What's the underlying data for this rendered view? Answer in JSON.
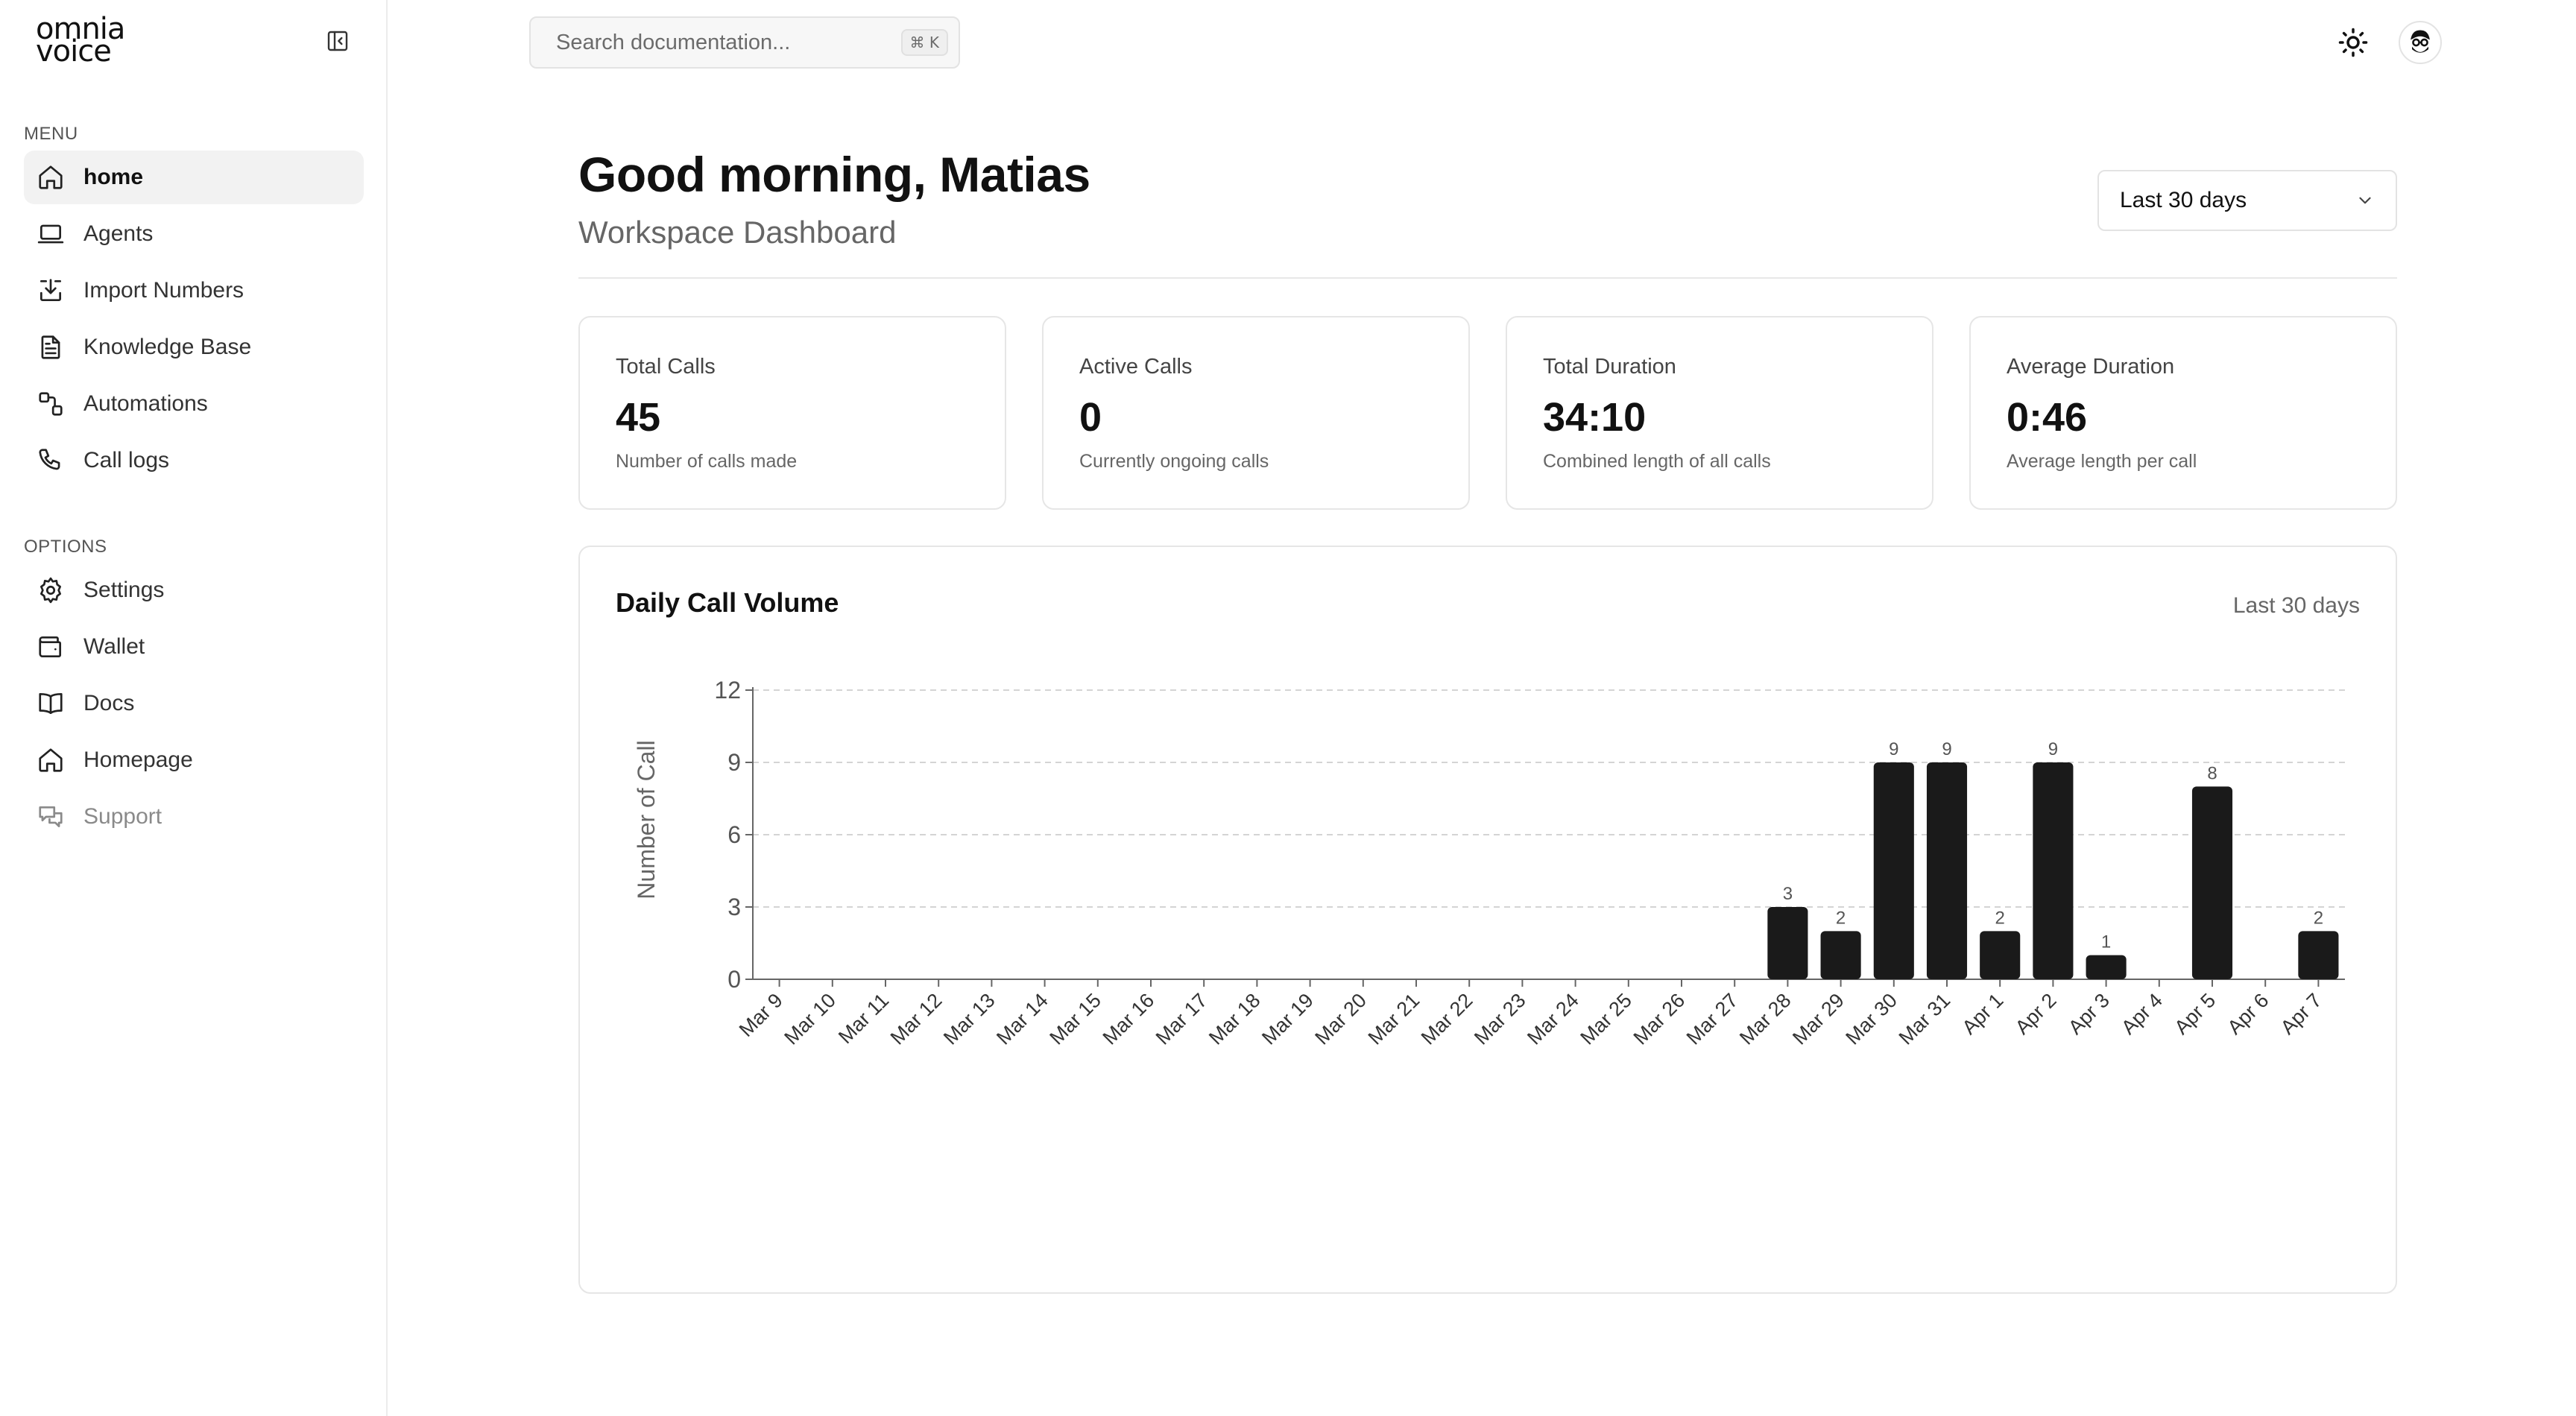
{
  "brand": {
    "line1": "omnia",
    "line2": "voice"
  },
  "sidebar": {
    "menu_label": "MENU",
    "options_label": "OPTIONS",
    "menu_items": [
      {
        "label": "home",
        "icon": "home-icon",
        "active": true
      },
      {
        "label": "Agents",
        "icon": "laptop-icon"
      },
      {
        "label": "Import Numbers",
        "icon": "import-icon"
      },
      {
        "label": "Knowledge Base",
        "icon": "document-icon"
      },
      {
        "label": "Automations",
        "icon": "workflow-icon"
      },
      {
        "label": "Call logs",
        "icon": "phone-icon"
      }
    ],
    "option_items": [
      {
        "label": "Settings",
        "icon": "gear-icon"
      },
      {
        "label": "Wallet",
        "icon": "wallet-icon"
      },
      {
        "label": "Docs",
        "icon": "book-icon"
      },
      {
        "label": "Homepage",
        "icon": "home-icon"
      },
      {
        "label": "Support",
        "icon": "chat-icon",
        "muted": true
      }
    ]
  },
  "topbar": {
    "search_placeholder": "Search documentation...",
    "search_shortcut": "⌘ K"
  },
  "header": {
    "greeting": "Good morning, Matias",
    "subtitle": "Workspace Dashboard",
    "range_label": "Last 30 days"
  },
  "stats": [
    {
      "label": "Total Calls",
      "value": "45",
      "desc": "Number of calls made"
    },
    {
      "label": "Active Calls",
      "value": "0",
      "desc": "Currently ongoing calls"
    },
    {
      "label": "Total Duration",
      "value": "34:10",
      "desc": "Combined length of all calls"
    },
    {
      "label": "Average Duration",
      "value": "0:46",
      "desc": "Average length per call"
    }
  ],
  "chart_card": {
    "title": "Daily Call Volume",
    "range": "Last 30 days"
  },
  "chart_data": {
    "type": "bar",
    "title": "Daily Call Volume",
    "xlabel": "",
    "ylabel": "Number of Call",
    "ylim": [
      0,
      12
    ],
    "yticks": [
      0,
      3,
      6,
      9,
      12
    ],
    "grid": true,
    "bar_color": "#1a1a1a",
    "categories": [
      "Mar 9",
      "Mar 10",
      "Mar 11",
      "Mar 12",
      "Mar 13",
      "Mar 14",
      "Mar 15",
      "Mar 16",
      "Mar 17",
      "Mar 18",
      "Mar 19",
      "Mar 20",
      "Mar 21",
      "Mar 22",
      "Mar 23",
      "Mar 24",
      "Mar 25",
      "Mar 26",
      "Mar 27",
      "Mar 28",
      "Mar 29",
      "Mar 30",
      "Mar 31",
      "Apr 1",
      "Apr 2",
      "Apr 3",
      "Apr 4",
      "Apr 5",
      "Apr 6",
      "Apr 7"
    ],
    "values": [
      0,
      0,
      0,
      0,
      0,
      0,
      0,
      0,
      0,
      0,
      0,
      0,
      0,
      0,
      0,
      0,
      0,
      0,
      0,
      3,
      2,
      9,
      9,
      2,
      9,
      1,
      0,
      8,
      0,
      2
    ]
  }
}
